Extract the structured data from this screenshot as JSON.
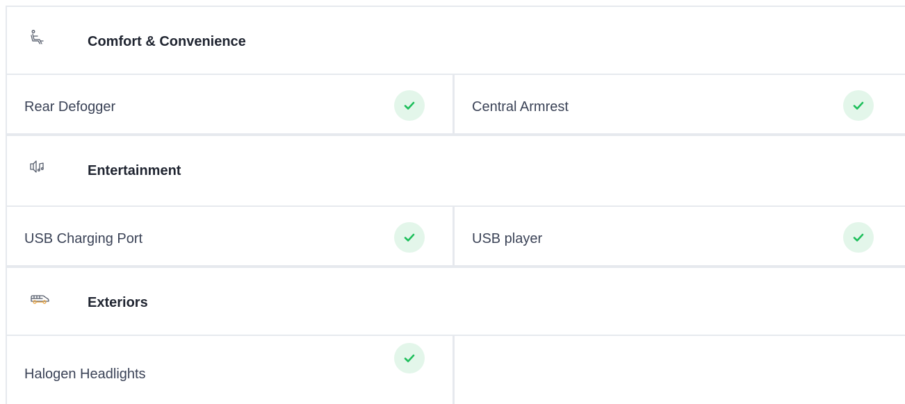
{
  "sections": [
    {
      "title": "Comfort & Convenience",
      "icon": "seat-icon",
      "features": [
        "Rear Defogger",
        "Central Armrest"
      ]
    },
    {
      "title": "Entertainment",
      "icon": "speaker-music-icon",
      "features": [
        "USB Charging Port",
        "USB player"
      ]
    },
    {
      "title": "Exteriors",
      "icon": "car-exterior-icon",
      "features": [
        "Halogen Headlights"
      ]
    }
  ],
  "colors": {
    "border": "#e6e9ee",
    "check_bg": "#e3f6ea",
    "check_fg": "#1fbf5c",
    "title_text": "#1f2430",
    "label_text": "#3a4256",
    "exterior_accent": "#e8a13a"
  }
}
